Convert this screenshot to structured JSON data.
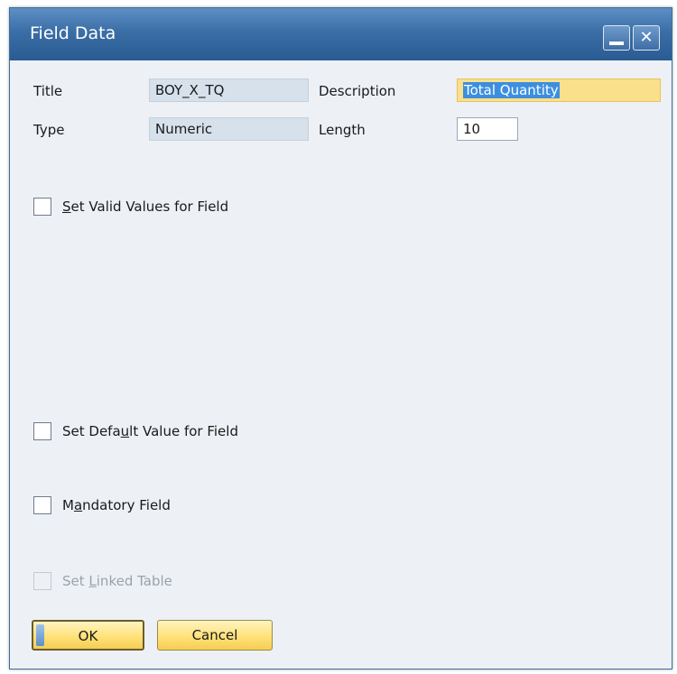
{
  "window": {
    "title": "Field Data",
    "minimize_label": "",
    "close_label": "✕"
  },
  "fields": {
    "title_label": "Title",
    "title_value": "BOY_X_TQ",
    "description_label": "Description",
    "description_value": "Total Quantity",
    "type_label": "Type",
    "type_value": "Numeric",
    "length_label": "Length",
    "length_value": "10"
  },
  "options": {
    "valid_values": {
      "pre": "",
      "mnemonic": "S",
      "post": "et Valid Values for Field",
      "checked": false
    },
    "default_value": {
      "pre": "Set Defa",
      "mnemonic": "u",
      "post": "lt Value for Field",
      "checked": false
    },
    "mandatory": {
      "pre": "M",
      "mnemonic": "a",
      "post": "ndatory Field",
      "checked": false
    },
    "linked_table": {
      "pre": "Set ",
      "mnemonic": "L",
      "post": "inked Table",
      "checked": false,
      "disabled": true
    }
  },
  "buttons": {
    "ok": "OK",
    "cancel": "Cancel"
  },
  "colors": {
    "titlebar": "#3b6ea6",
    "body": "#edf1f6",
    "readonly_field": "#d6e1ec",
    "highlight_field": "#fbe08c",
    "selection": "#3c8fe0",
    "button": "#ffe27a"
  }
}
